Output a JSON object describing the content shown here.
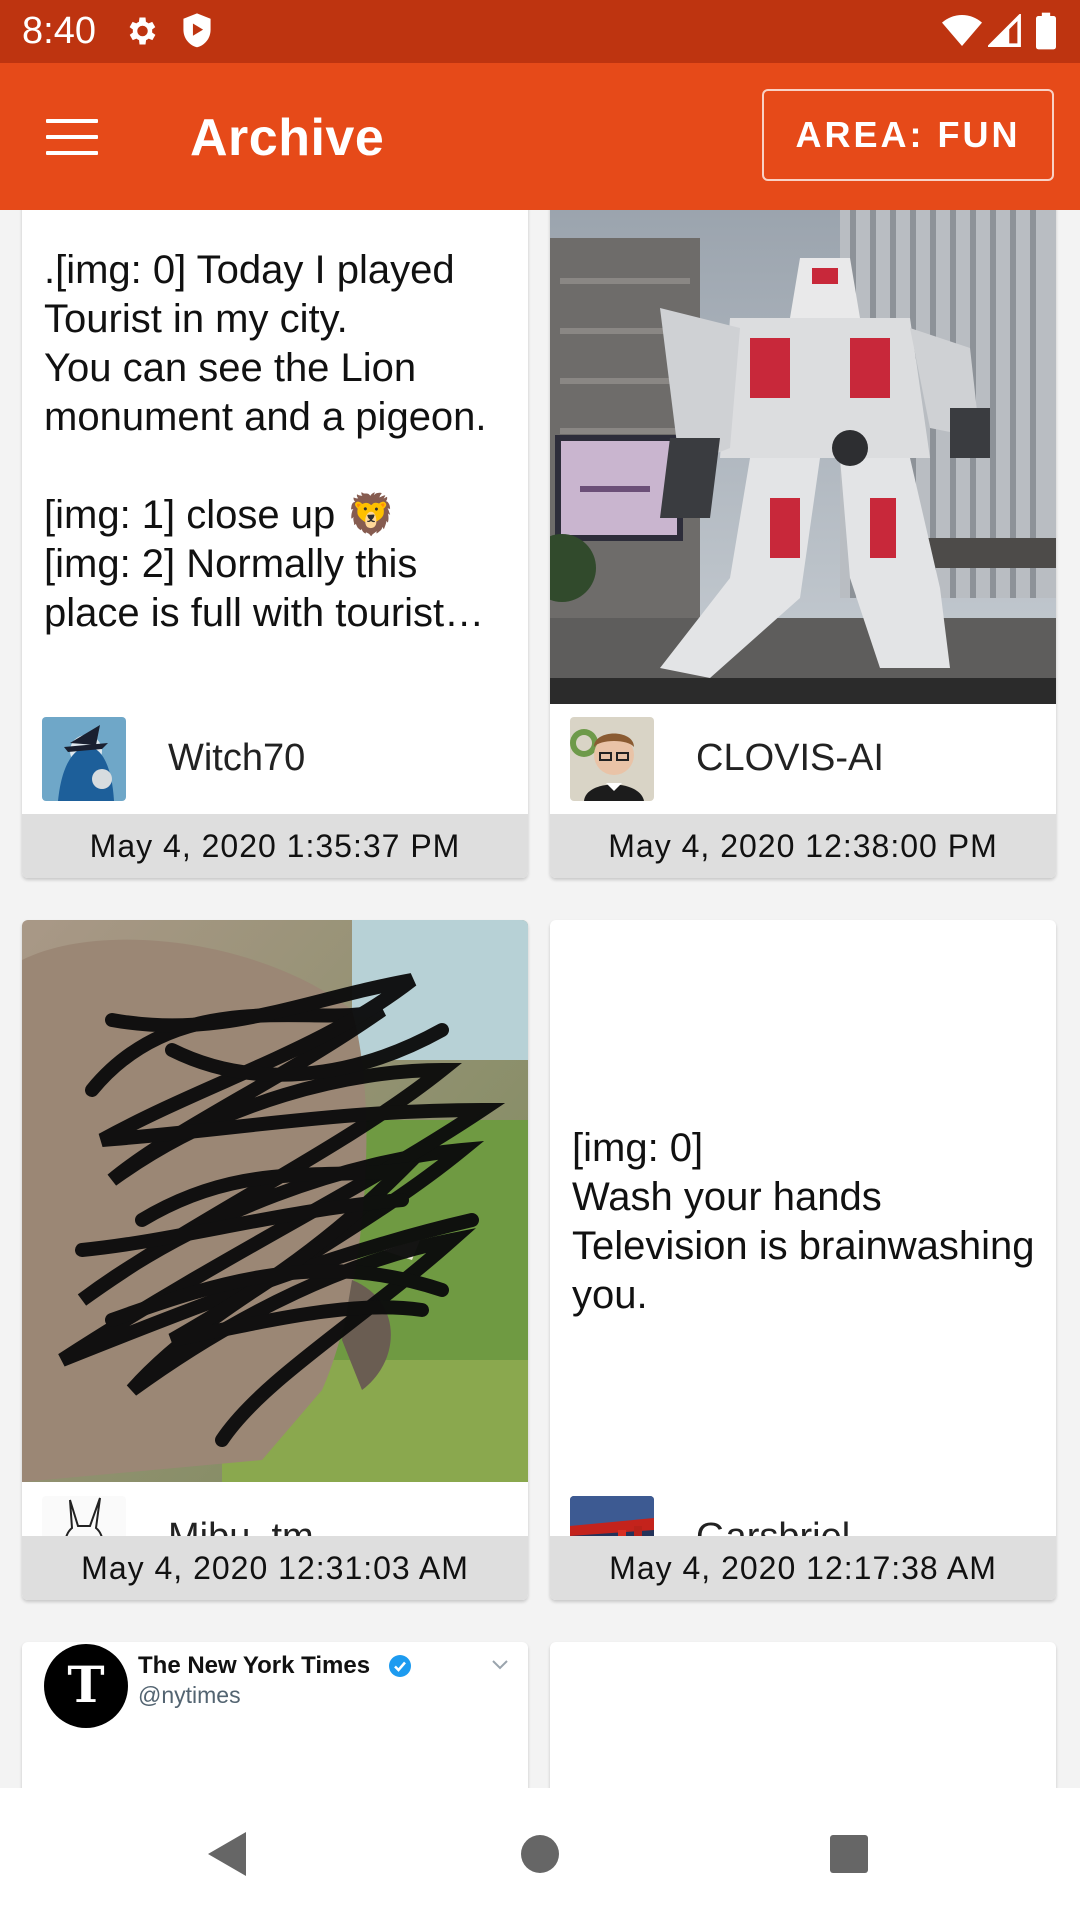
{
  "status_bar": {
    "time": "8:40",
    "icons": [
      "gear-icon",
      "shield-icon",
      "wifi-icon",
      "signal-icon",
      "battery-icon"
    ]
  },
  "app_bar": {
    "menu_icon": "menu-icon",
    "title": "Archive",
    "area_button": "AREA: FUN"
  },
  "cards": [
    {
      "text": ".[img: 0] Today I played Tourist in my city.\nYou can see the Lion monument and a pigeon.\n\n[img: 1] close up 🦁\n[img: 2] Normally this place is full with tourist…",
      "user": "Witch70",
      "date": "May 4, 2020 1:35:37 PM"
    },
    {
      "image": "robot-statue-photo",
      "user": "CLOVIS-AI",
      "date": "May 4, 2020 12:38:00 PM"
    },
    {
      "image": "scribbled-elephant-photo",
      "user": "Mibu_tm",
      "date": "May 4, 2020 12:31:03 AM"
    },
    {
      "text": "[img: 0]\nWash your hands\nTelevision is brainwashing you.",
      "user": "Garsbriel",
      "date": "May 4, 2020 12:17:38 AM"
    }
  ],
  "tweet": {
    "name": "The New York Times",
    "handle": "@nytimes",
    "verified_icon": "verified-badge-icon",
    "chevron_icon": "chevron-down-icon"
  },
  "nav_bar": {
    "icons": [
      "back-icon",
      "home-icon",
      "recents-icon"
    ]
  },
  "colors": {
    "status_bar": "#be3410",
    "app_bar": "#e64a19",
    "date_strip": "#dedede"
  }
}
